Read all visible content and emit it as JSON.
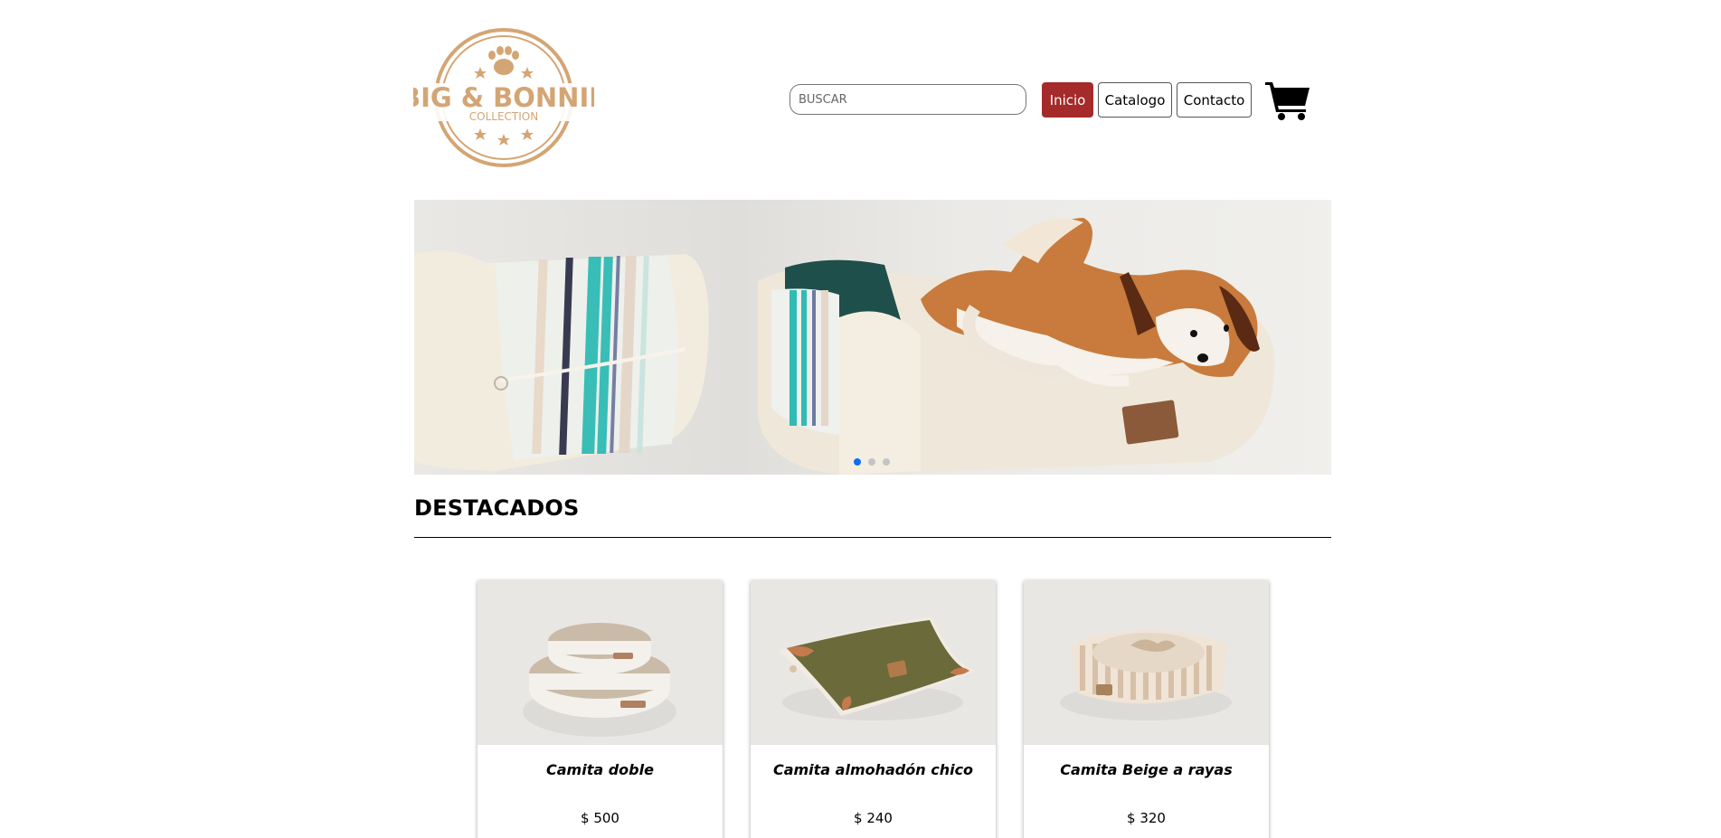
{
  "header": {
    "logo": {
      "line1": "BIG & BONNIE",
      "line2": "COLLECTION",
      "color": "#d4a574"
    },
    "search": {
      "placeholder": "BUSCAR",
      "value": ""
    },
    "nav": [
      {
        "label": "Inicio",
        "active": true
      },
      {
        "label": "Catalogo",
        "active": false
      },
      {
        "label": "Contacto",
        "active": false
      }
    ],
    "cart_icon": "shopping-cart-icon"
  },
  "carousel": {
    "slides": 3,
    "active_slide": 1,
    "accent": "#0d6efd"
  },
  "featured": {
    "title": "DESTACADOS",
    "products": [
      {
        "name": "Camita doble",
        "price": "$ 500"
      },
      {
        "name": "Camita almohadón chico",
        "price": "$ 240"
      },
      {
        "name": "Camita Beige a rayas",
        "price": "$ 320"
      }
    ]
  },
  "colors": {
    "active_nav": "#a52a2a",
    "logo_gold": "#d4a574"
  }
}
